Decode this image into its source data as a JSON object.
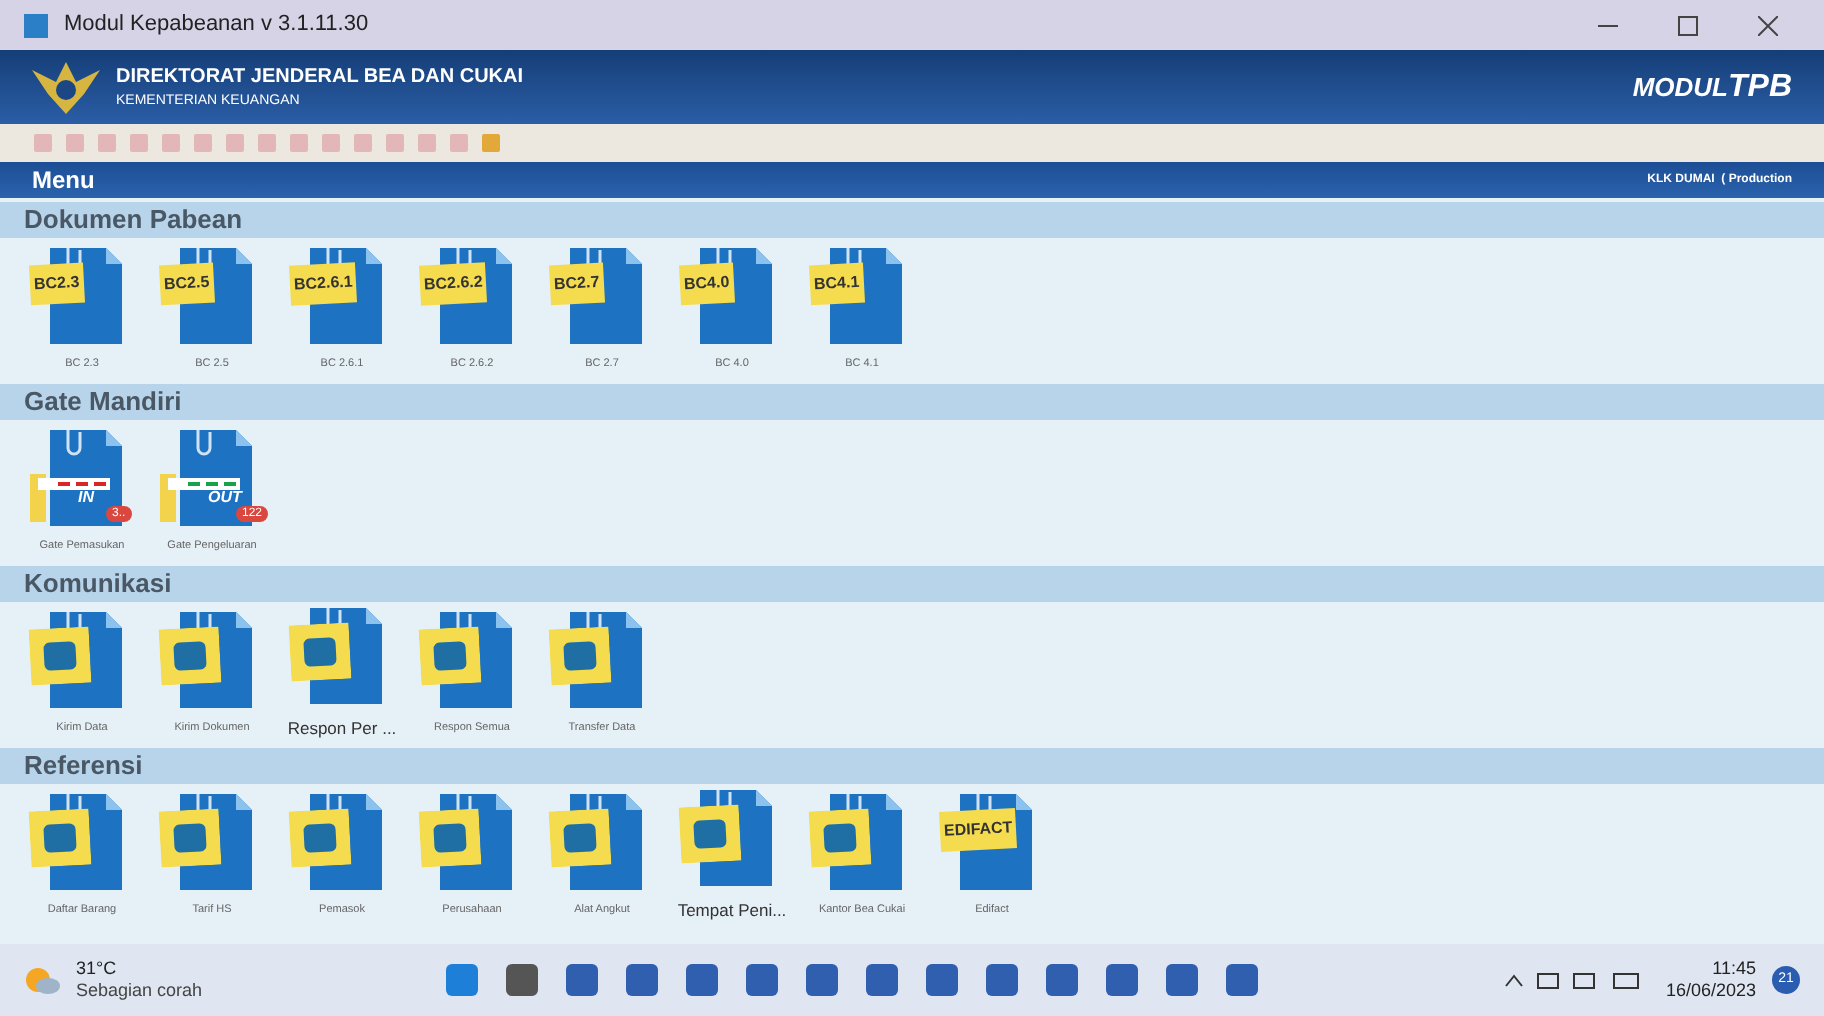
{
  "window": {
    "title": "Modul Kepabeanan v 3.1.11.30"
  },
  "header": {
    "title": "DIREKTORAT JENDERAL BEA DAN CUKAI",
    "subtitle": "KEMENTERIAN KEUANGAN",
    "brand_prefix": "MODUL",
    "brand_suffix": "TPB"
  },
  "toolbar": [
    {
      "disabled": true
    },
    {
      "disabled": true
    },
    {
      "disabled": true
    },
    {
      "disabled": true
    },
    {
      "disabled": true
    },
    {
      "disabled": true
    },
    {
      "disabled": true
    },
    {
      "disabled": true
    },
    {
      "disabled": true
    },
    {
      "disabled": true
    },
    {
      "disabled": true
    },
    {
      "disabled": true
    },
    {
      "disabled": true
    },
    {
      "disabled": true
    },
    {
      "disabled": false
    }
  ],
  "menu_bar": {
    "title": "Menu",
    "status": "KLK DUMAI  ( Production"
  },
  "sections": [
    {
      "title": "Dokumen Pabean",
      "items": [
        {
          "note": "BC2.3",
          "label": "BC 2.3",
          "highlighted": false
        },
        {
          "note": "BC2.5",
          "label": "BC 2.5",
          "highlighted": false
        },
        {
          "note": "BC2.6.1",
          "label": "BC 2.6.1",
          "highlighted": false
        },
        {
          "note": "BC2.6.2",
          "label": "BC 2.6.2",
          "highlighted": false
        },
        {
          "note": "BC2.7",
          "label": "BC 2.7",
          "highlighted": false
        },
        {
          "note": "BC4.0",
          "label": "BC 4.0",
          "highlighted": false
        },
        {
          "note": "BC4.1",
          "label": "BC 4.1",
          "highlighted": false
        }
      ]
    },
    {
      "title": "Gate Mandiri",
      "items": [
        {
          "gate": "IN",
          "badge": "3..",
          "label": "Gate Pemasukan",
          "highlighted": false
        },
        {
          "gate": "OUT",
          "badge": "122",
          "label": "Gate Pengeluaran",
          "highlighted": false
        }
      ]
    },
    {
      "title": "Komunikasi",
      "items": [
        {
          "label": "Kirim Data",
          "highlighted": false
        },
        {
          "label": "Kirim Dokumen",
          "highlighted": false
        },
        {
          "label": "Respon Per ...",
          "highlighted": true
        },
        {
          "label": "Respon Semua",
          "highlighted": false
        },
        {
          "label": "Transfer Data",
          "highlighted": false
        }
      ]
    },
    {
      "title": "Referensi",
      "items": [
        {
          "label": "Daftar Barang",
          "highlighted": false
        },
        {
          "label": "Tarif HS",
          "highlighted": false
        },
        {
          "label": "Pemasok",
          "highlighted": false
        },
        {
          "label": "Perusahaan",
          "highlighted": false
        },
        {
          "label": "Alat Angkut",
          "highlighted": false
        },
        {
          "label": "Tempat Peni...",
          "highlighted": true
        },
        {
          "label": "Kantor Bea Cukai",
          "highlighted": false
        },
        {
          "note": "EDIFACT",
          "label": "Edifact",
          "highlighted": false
        }
      ]
    }
  ],
  "taskbar": {
    "temperature": "31°C",
    "weather": "Sebagian corah",
    "time": "11:45",
    "date": "16/06/2023",
    "notifications": "21"
  }
}
